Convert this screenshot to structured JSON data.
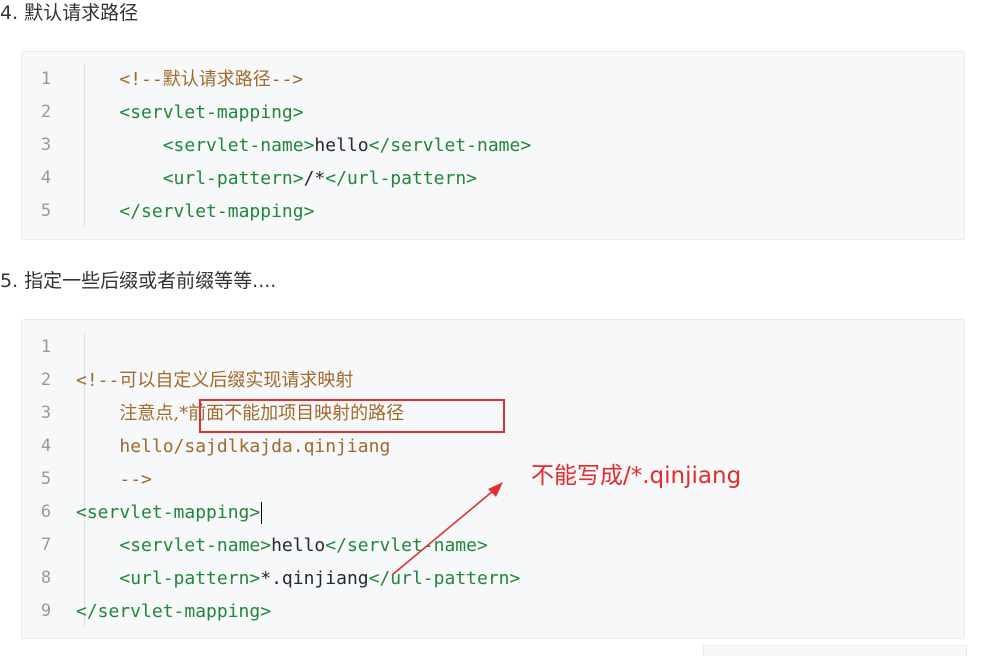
{
  "section4": {
    "heading": "4. 默认请求路径",
    "lines": [
      {
        "num": "1",
        "indent": "    ",
        "parts": [
          {
            "t": "<!--默认请求路径-->",
            "c": "cmt"
          }
        ]
      },
      {
        "num": "2",
        "indent": "    ",
        "parts": [
          {
            "t": "<servlet-mapping>",
            "c": "tag"
          }
        ]
      },
      {
        "num": "3",
        "indent": "        ",
        "parts": [
          {
            "t": "<servlet-name>",
            "c": "tag"
          },
          {
            "t": "hello",
            "c": "txt"
          },
          {
            "t": "</servlet-name>",
            "c": "tag"
          }
        ]
      },
      {
        "num": "4",
        "indent": "        ",
        "parts": [
          {
            "t": "<url-pattern>",
            "c": "tag"
          },
          {
            "t": "/*",
            "c": "txt"
          },
          {
            "t": "</url-pattern>",
            "c": "tag"
          }
        ]
      },
      {
        "num": "5",
        "indent": "    ",
        "parts": [
          {
            "t": "</servlet-mapping>",
            "c": "tag"
          }
        ]
      }
    ]
  },
  "section5": {
    "heading": "5. 指定一些后缀或者前缀等等....",
    "lines": [
      {
        "num": "1",
        "indent": "",
        "parts": []
      },
      {
        "num": "2",
        "indent": "",
        "parts": [
          {
            "t": "<!--",
            "c": "cmt"
          },
          {
            "t": "可以自定义后缀实现请求映射",
            "c": "cmt cjk-cmt"
          }
        ]
      },
      {
        "num": "3",
        "indent": "    ",
        "parts": [
          {
            "t": "注意点,",
            "c": "cmt cjk-cmt"
          },
          {
            "t": "*前面不能加项目映射的路径",
            "c": "cmt cjk-cmt"
          }
        ]
      },
      {
        "num": "4",
        "indent": "    ",
        "parts": [
          {
            "t": "hello/sajdlkajda.qinjiang",
            "c": "cmt"
          }
        ]
      },
      {
        "num": "5",
        "indent": "    ",
        "parts": [
          {
            "t": "-->",
            "c": "cmt"
          }
        ]
      },
      {
        "num": "6",
        "indent": "",
        "parts": [
          {
            "t": "<servlet-mapping>",
            "c": "tag"
          }
        ],
        "caret": true
      },
      {
        "num": "7",
        "indent": "    ",
        "parts": [
          {
            "t": "<servlet-name>",
            "c": "tag"
          },
          {
            "t": "hello",
            "c": "txt"
          },
          {
            "t": "</servlet-name>",
            "c": "tag"
          }
        ]
      },
      {
        "num": "8",
        "indent": "    ",
        "parts": [
          {
            "t": "<url-pattern>",
            "c": "tag"
          },
          {
            "t": "*.qinjiang",
            "c": "txt"
          },
          {
            "t": "</url-pattern>",
            "c": "tag"
          }
        ]
      },
      {
        "num": "9",
        "indent": "",
        "parts": [
          {
            "t": "</servlet-mapping>",
            "c": "tag"
          }
        ]
      }
    ]
  },
  "annotation": {
    "text": "不能写成/*.qinjiang",
    "color": "#e32b2b"
  },
  "colors": {
    "tag": "#22863a",
    "text": "#24292e",
    "comment": "#a06a2c",
    "line_number": "#999999",
    "code_background": "#f6f8fa"
  }
}
